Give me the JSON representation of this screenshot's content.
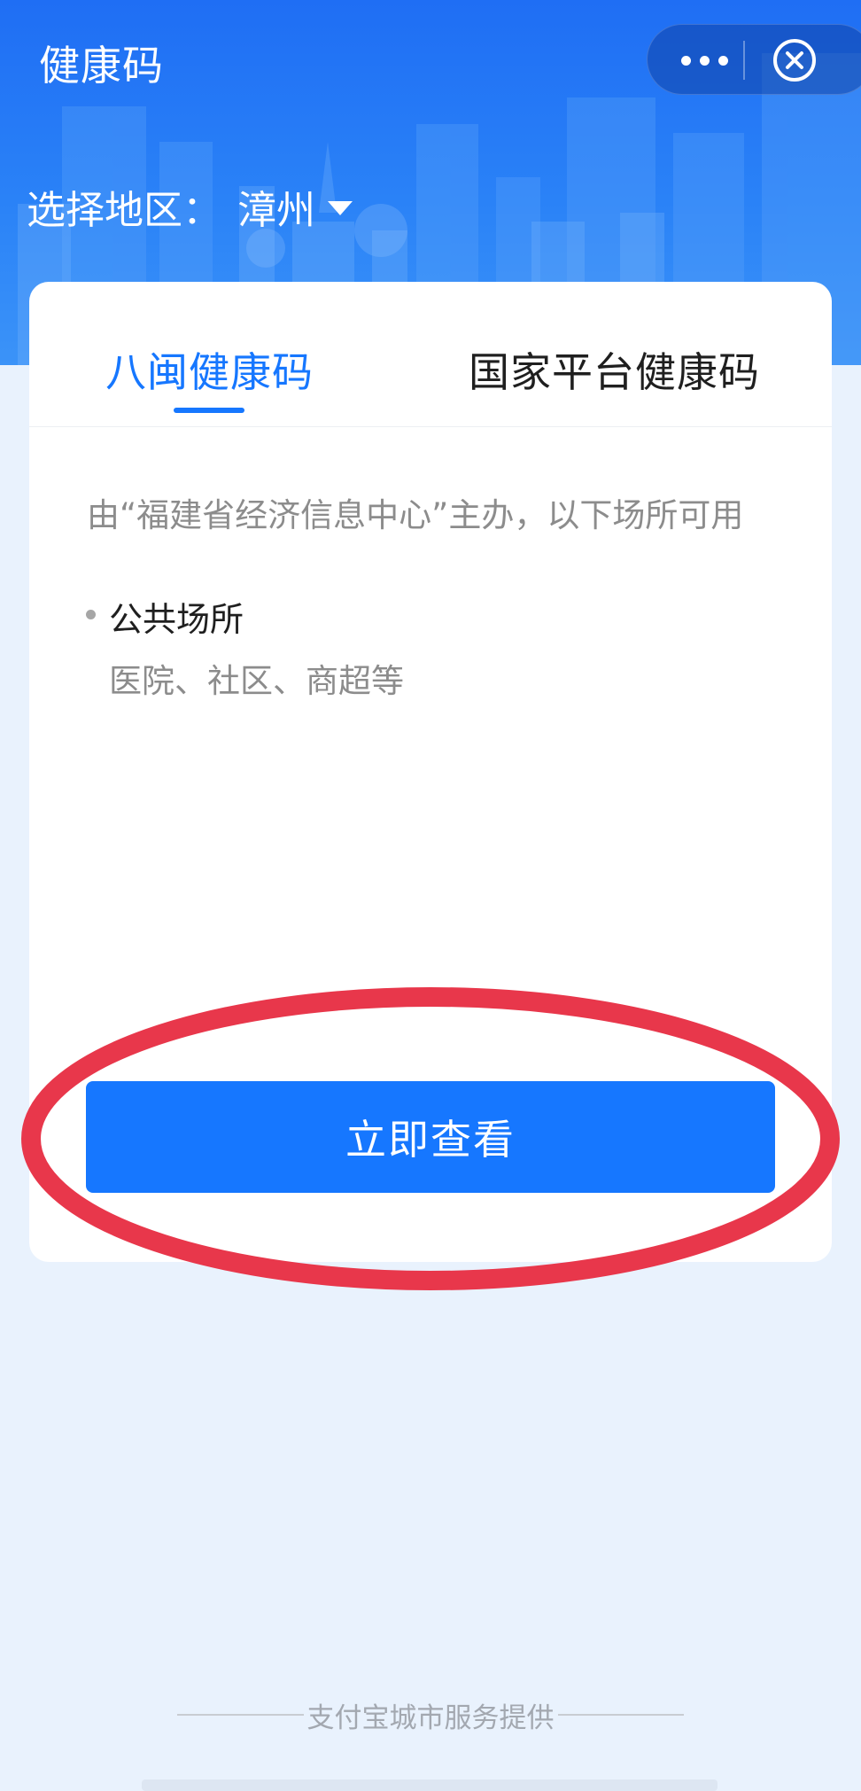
{
  "header": {
    "title": "健康码",
    "more_icon": "more-dots-icon",
    "close_icon": "close-circle-icon"
  },
  "region": {
    "label": "选择地区：",
    "value": "漳州",
    "caret_icon": "caret-down-icon"
  },
  "tabs": [
    {
      "label": "八闽健康码",
      "active": true
    },
    {
      "label": "国家平台健康码",
      "active": false
    }
  ],
  "card": {
    "description": "由“福建省经济信息中心”主办，以下场所可用",
    "venue": {
      "title": "公共场所",
      "subtitle": "医院、社区、商超等"
    },
    "view_button": "立即查看"
  },
  "footer": {
    "provider": "支付宝城市服务提供"
  },
  "colors": {
    "brand_blue": "#1677ff",
    "header_blue": "#1f6ef4",
    "annotation_red": "#e8374b",
    "page_bg": "#e9f2fd"
  }
}
